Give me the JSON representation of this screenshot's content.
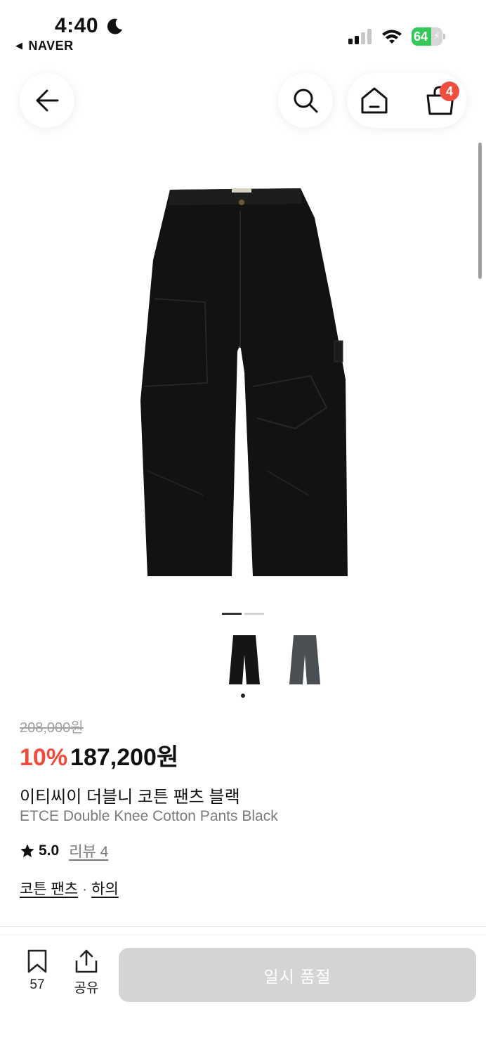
{
  "status_bar": {
    "time": "4:40",
    "back_app": "NAVER",
    "battery_level": 64,
    "icons": [
      "moon-icon",
      "signal-icon",
      "wifi-icon",
      "battery-icon"
    ]
  },
  "header": {
    "cart_badge_count": "4",
    "icons": [
      "back-arrow-icon",
      "search-icon",
      "home-icon",
      "cart-icon"
    ]
  },
  "gallery": {
    "current_index": 0,
    "page_count": 2,
    "thumbnails": [
      "black",
      "grey"
    ]
  },
  "product": {
    "original_price": "208,000원",
    "discount": "10%",
    "sale_price": "187,200원",
    "title_ko": "이티씨이 더블니 코튼 팬츠 블랙",
    "title_en": "ETCE Double Knee Cotton Pants Black",
    "rating": "5.0",
    "review_link": "리뷰 4",
    "categories": [
      "코튼 팬츠",
      "하의"
    ],
    "category_separator": "·"
  },
  "bottom_bar": {
    "bookmark_count": "57",
    "share_label": "공유",
    "purchase_button": "일시 품절"
  },
  "colors": {
    "accent_red": "#ef4a3c",
    "badge_red": "#f04e3e",
    "disabled_button": "#d4d4d4",
    "battery_green": "#34c759"
  }
}
